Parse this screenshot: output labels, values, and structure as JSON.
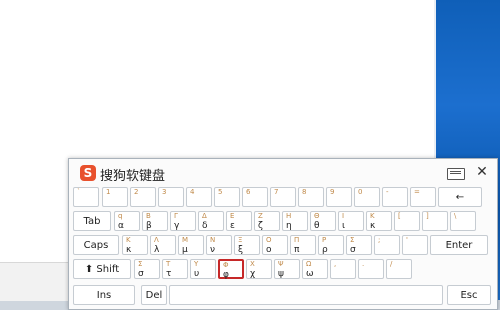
{
  "window": {
    "title": "搜狗软键盘",
    "logo": "S"
  },
  "controls": {
    "close": "✕"
  },
  "rows": [
    {
      "keys": [
        {
          "t": "`",
          "b": ""
        },
        {
          "t": "1",
          "b": ""
        },
        {
          "t": "2",
          "b": ""
        },
        {
          "t": "3",
          "b": ""
        },
        {
          "t": "4",
          "b": ""
        },
        {
          "t": "5",
          "b": ""
        },
        {
          "t": "6",
          "b": ""
        },
        {
          "t": "7",
          "b": ""
        },
        {
          "t": "8",
          "b": ""
        },
        {
          "t": "9",
          "b": ""
        },
        {
          "t": "0",
          "b": ""
        },
        {
          "t": "-",
          "b": ""
        },
        {
          "t": "=",
          "b": ""
        },
        {
          "fn": "←"
        }
      ]
    },
    {
      "keys": [
        {
          "fn": "Tab"
        },
        {
          "t": "q",
          "b": "α"
        },
        {
          "t": "Β",
          "b": "β"
        },
        {
          "t": "Γ",
          "b": "γ"
        },
        {
          "t": "Δ",
          "b": "δ"
        },
        {
          "t": "Ε",
          "b": "ε"
        },
        {
          "t": "Ζ",
          "b": "ζ"
        },
        {
          "t": "Η",
          "b": "η"
        },
        {
          "t": "Θ",
          "b": "θ"
        },
        {
          "t": "Ι",
          "b": "ι"
        },
        {
          "t": "Κ",
          "b": "κ"
        },
        {
          "t": "[",
          "b": ""
        },
        {
          "t": "]",
          "b": ""
        },
        {
          "t": "\\",
          "b": ""
        }
      ]
    },
    {
      "keys": [
        {
          "fn": "Caps"
        },
        {
          "t": "Κ",
          "b": "κ"
        },
        {
          "t": "Λ",
          "b": "λ"
        },
        {
          "t": "Μ",
          "b": "μ"
        },
        {
          "t": "Ν",
          "b": "ν"
        },
        {
          "t": "Ξ",
          "b": "ξ"
        },
        {
          "t": "Ο",
          "b": "ο"
        },
        {
          "t": "Π",
          "b": "π"
        },
        {
          "t": "Ρ",
          "b": "ρ"
        },
        {
          "t": "Σ",
          "b": "σ"
        },
        {
          "t": ";",
          "b": ""
        },
        {
          "t": "'",
          "b": ""
        },
        {
          "fn": "Enter"
        }
      ]
    },
    {
      "keys": [
        {
          "fn": "⬆ Shift"
        },
        {
          "t": "Σ",
          "b": "σ"
        },
        {
          "t": "Τ",
          "b": "τ"
        },
        {
          "t": "Υ",
          "b": "υ"
        },
        {
          "t": "Φ",
          "b": "φ",
          "hl": true
        },
        {
          "t": "Χ",
          "b": "χ"
        },
        {
          "t": "Ψ",
          "b": "ψ"
        },
        {
          "t": "Ω",
          "b": "ω"
        },
        {
          "t": ",",
          "b": ""
        },
        {
          "t": ".",
          "b": ""
        },
        {
          "t": "/",
          "b": ""
        }
      ]
    },
    {
      "keys": [
        {
          "fn": "Ins"
        },
        {
          "fn": "Del"
        },
        {
          "fn": ""
        },
        {
          "fn": "Esc"
        }
      ]
    }
  ]
}
